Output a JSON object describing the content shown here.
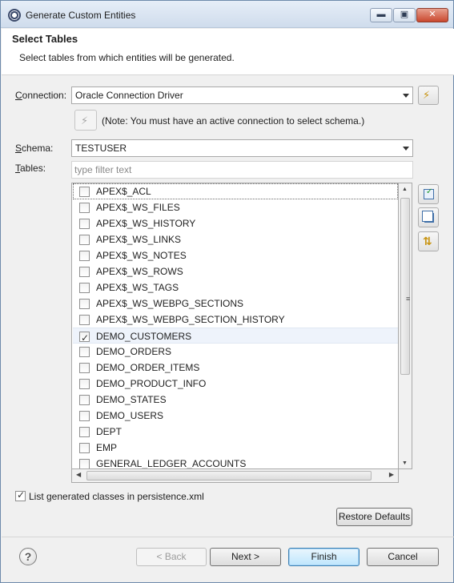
{
  "window": {
    "title": "Generate Custom Entities",
    "controls": {
      "minimize": "▬",
      "maximize": "▣",
      "close": "✕"
    }
  },
  "header": {
    "title": "Select Tables",
    "description": "Select tables from which entities will be generated."
  },
  "connection": {
    "label_mnemonic": "C",
    "label_rest": "onnection:",
    "value": "Oracle Connection Driver"
  },
  "note": "(Note: You must have an active connection to select schema.)",
  "schema": {
    "label_mnemonic": "S",
    "label_rest": "chema:",
    "value": "TESTUSER"
  },
  "tables": {
    "label_mnemonic": "T",
    "label_rest": "ables:",
    "filter_placeholder": "type filter text",
    "rows": [
      {
        "name": "APEX$_ACL",
        "checked": false,
        "focused": true
      },
      {
        "name": "APEX$_WS_FILES",
        "checked": false
      },
      {
        "name": "APEX$_WS_HISTORY",
        "checked": false
      },
      {
        "name": "APEX$_WS_LINKS",
        "checked": false
      },
      {
        "name": "APEX$_WS_NOTES",
        "checked": false
      },
      {
        "name": "APEX$_WS_ROWS",
        "checked": false
      },
      {
        "name": "APEX$_WS_TAGS",
        "checked": false
      },
      {
        "name": "APEX$_WS_WEBPG_SECTIONS",
        "checked": false
      },
      {
        "name": "APEX$_WS_WEBPG_SECTION_HISTORY",
        "checked": false
      },
      {
        "name": "DEMO_CUSTOMERS",
        "checked": true,
        "selected": true
      },
      {
        "name": "DEMO_ORDERS",
        "checked": false
      },
      {
        "name": "DEMO_ORDER_ITEMS",
        "checked": false
      },
      {
        "name": "DEMO_PRODUCT_INFO",
        "checked": false
      },
      {
        "name": "DEMO_STATES",
        "checked": false
      },
      {
        "name": "DEMO_USERS",
        "checked": false
      },
      {
        "name": "DEPT",
        "checked": false
      },
      {
        "name": "EMP",
        "checked": false
      },
      {
        "name": "GENERAL_LEDGER_ACCOUNTS",
        "checked": false
      }
    ]
  },
  "list_generated": {
    "label": "List generated classes in persistence.xml",
    "checked": true
  },
  "buttons": {
    "restore_defaults": "Restore Defaults",
    "back": "< Back",
    "next": "Next >",
    "finish": "Finish",
    "cancel": "Cancel",
    "help": "?"
  },
  "colors": {
    "accent": "#3c7fb1",
    "selection_row": "#eef3fb"
  }
}
